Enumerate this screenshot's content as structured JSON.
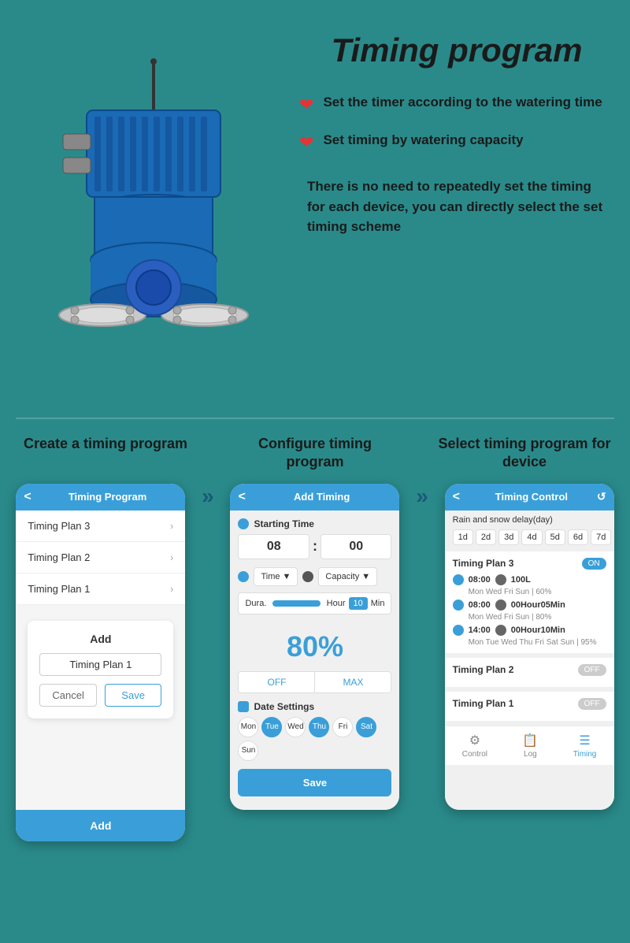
{
  "page": {
    "title": "Timing program",
    "background_color": "#2a8a8a"
  },
  "top_section": {
    "bullet1": {
      "text": "Set the timer according to the watering time"
    },
    "bullet2": {
      "text": "Set timing by watering capacity"
    },
    "description": "There is no need to repeatedly set the timing for each device, you can directly select the set timing scheme"
  },
  "phones": {
    "phone1": {
      "title_label": "Create a timing program",
      "header_title": "Timing Program",
      "list_items": [
        "Timing Plan 3",
        "Timing Plan 2",
        "Timing Plan 1"
      ],
      "dialog": {
        "label": "Add",
        "input_value": "Timing Plan 1",
        "cancel": "Cancel",
        "save": "Save"
      },
      "bottom_btn": "Add"
    },
    "arrow1": "»",
    "phone2": {
      "title_label": "Configure timing program",
      "header_title": "Add Timing",
      "starting_time_label": "Starting Time",
      "hour": "08",
      "minute": "00",
      "time_label": "Time",
      "capacity_label": "Capacity",
      "duration_label": "Dura.",
      "duration_unit1": "Hour",
      "duration_value": "10",
      "duration_unit2": "Min",
      "percentage": "80%",
      "off_label": "OFF",
      "max_label": "MAX",
      "date_settings_label": "Date Settings",
      "days": [
        {
          "label": "Mon",
          "active": false
        },
        {
          "label": "Tue",
          "active": true
        },
        {
          "label": "Wed",
          "active": false
        },
        {
          "label": "Thu",
          "active": true
        },
        {
          "label": "Fri",
          "active": false
        },
        {
          "label": "Sat",
          "active": true
        },
        {
          "label": "Sun",
          "active": false
        }
      ],
      "save_btn": "Save"
    },
    "arrow2": "»",
    "phone3": {
      "title_label": "Select timing program for device",
      "header_title": "Timing Control",
      "rain_delay": "Rain and snow delay(day)",
      "day_chips": [
        {
          "label": "1d",
          "active": false
        },
        {
          "label": "2d",
          "active": false
        },
        {
          "label": "3d",
          "active": false
        },
        {
          "label": "4d",
          "active": false
        },
        {
          "label": "5d",
          "active": false
        },
        {
          "label": "6d",
          "active": false
        },
        {
          "label": "7d",
          "active": false
        }
      ],
      "plan3": {
        "name": "Timing Plan 3",
        "toggle": "ON",
        "entries": [
          {
            "time": "08:00",
            "detail": "100L",
            "sub": "Mon Wed Fri Sun | 60%"
          },
          {
            "time": "08:00",
            "detail": "00Hour05Min",
            "sub": "Mon Wed Fri Sun | 80%"
          },
          {
            "time": "14:00",
            "detail": "00Hour10Min",
            "sub": "Mon Tue Wed Thu Fri Sat Sun | 95%"
          }
        ]
      },
      "plan2": {
        "name": "Timing Plan 2",
        "toggle": "OFF"
      },
      "plan1": {
        "name": "Timing Plan 1",
        "toggle": "OFF"
      },
      "nav": {
        "control": "Control",
        "log": "Log",
        "timing": "Timing"
      }
    }
  }
}
